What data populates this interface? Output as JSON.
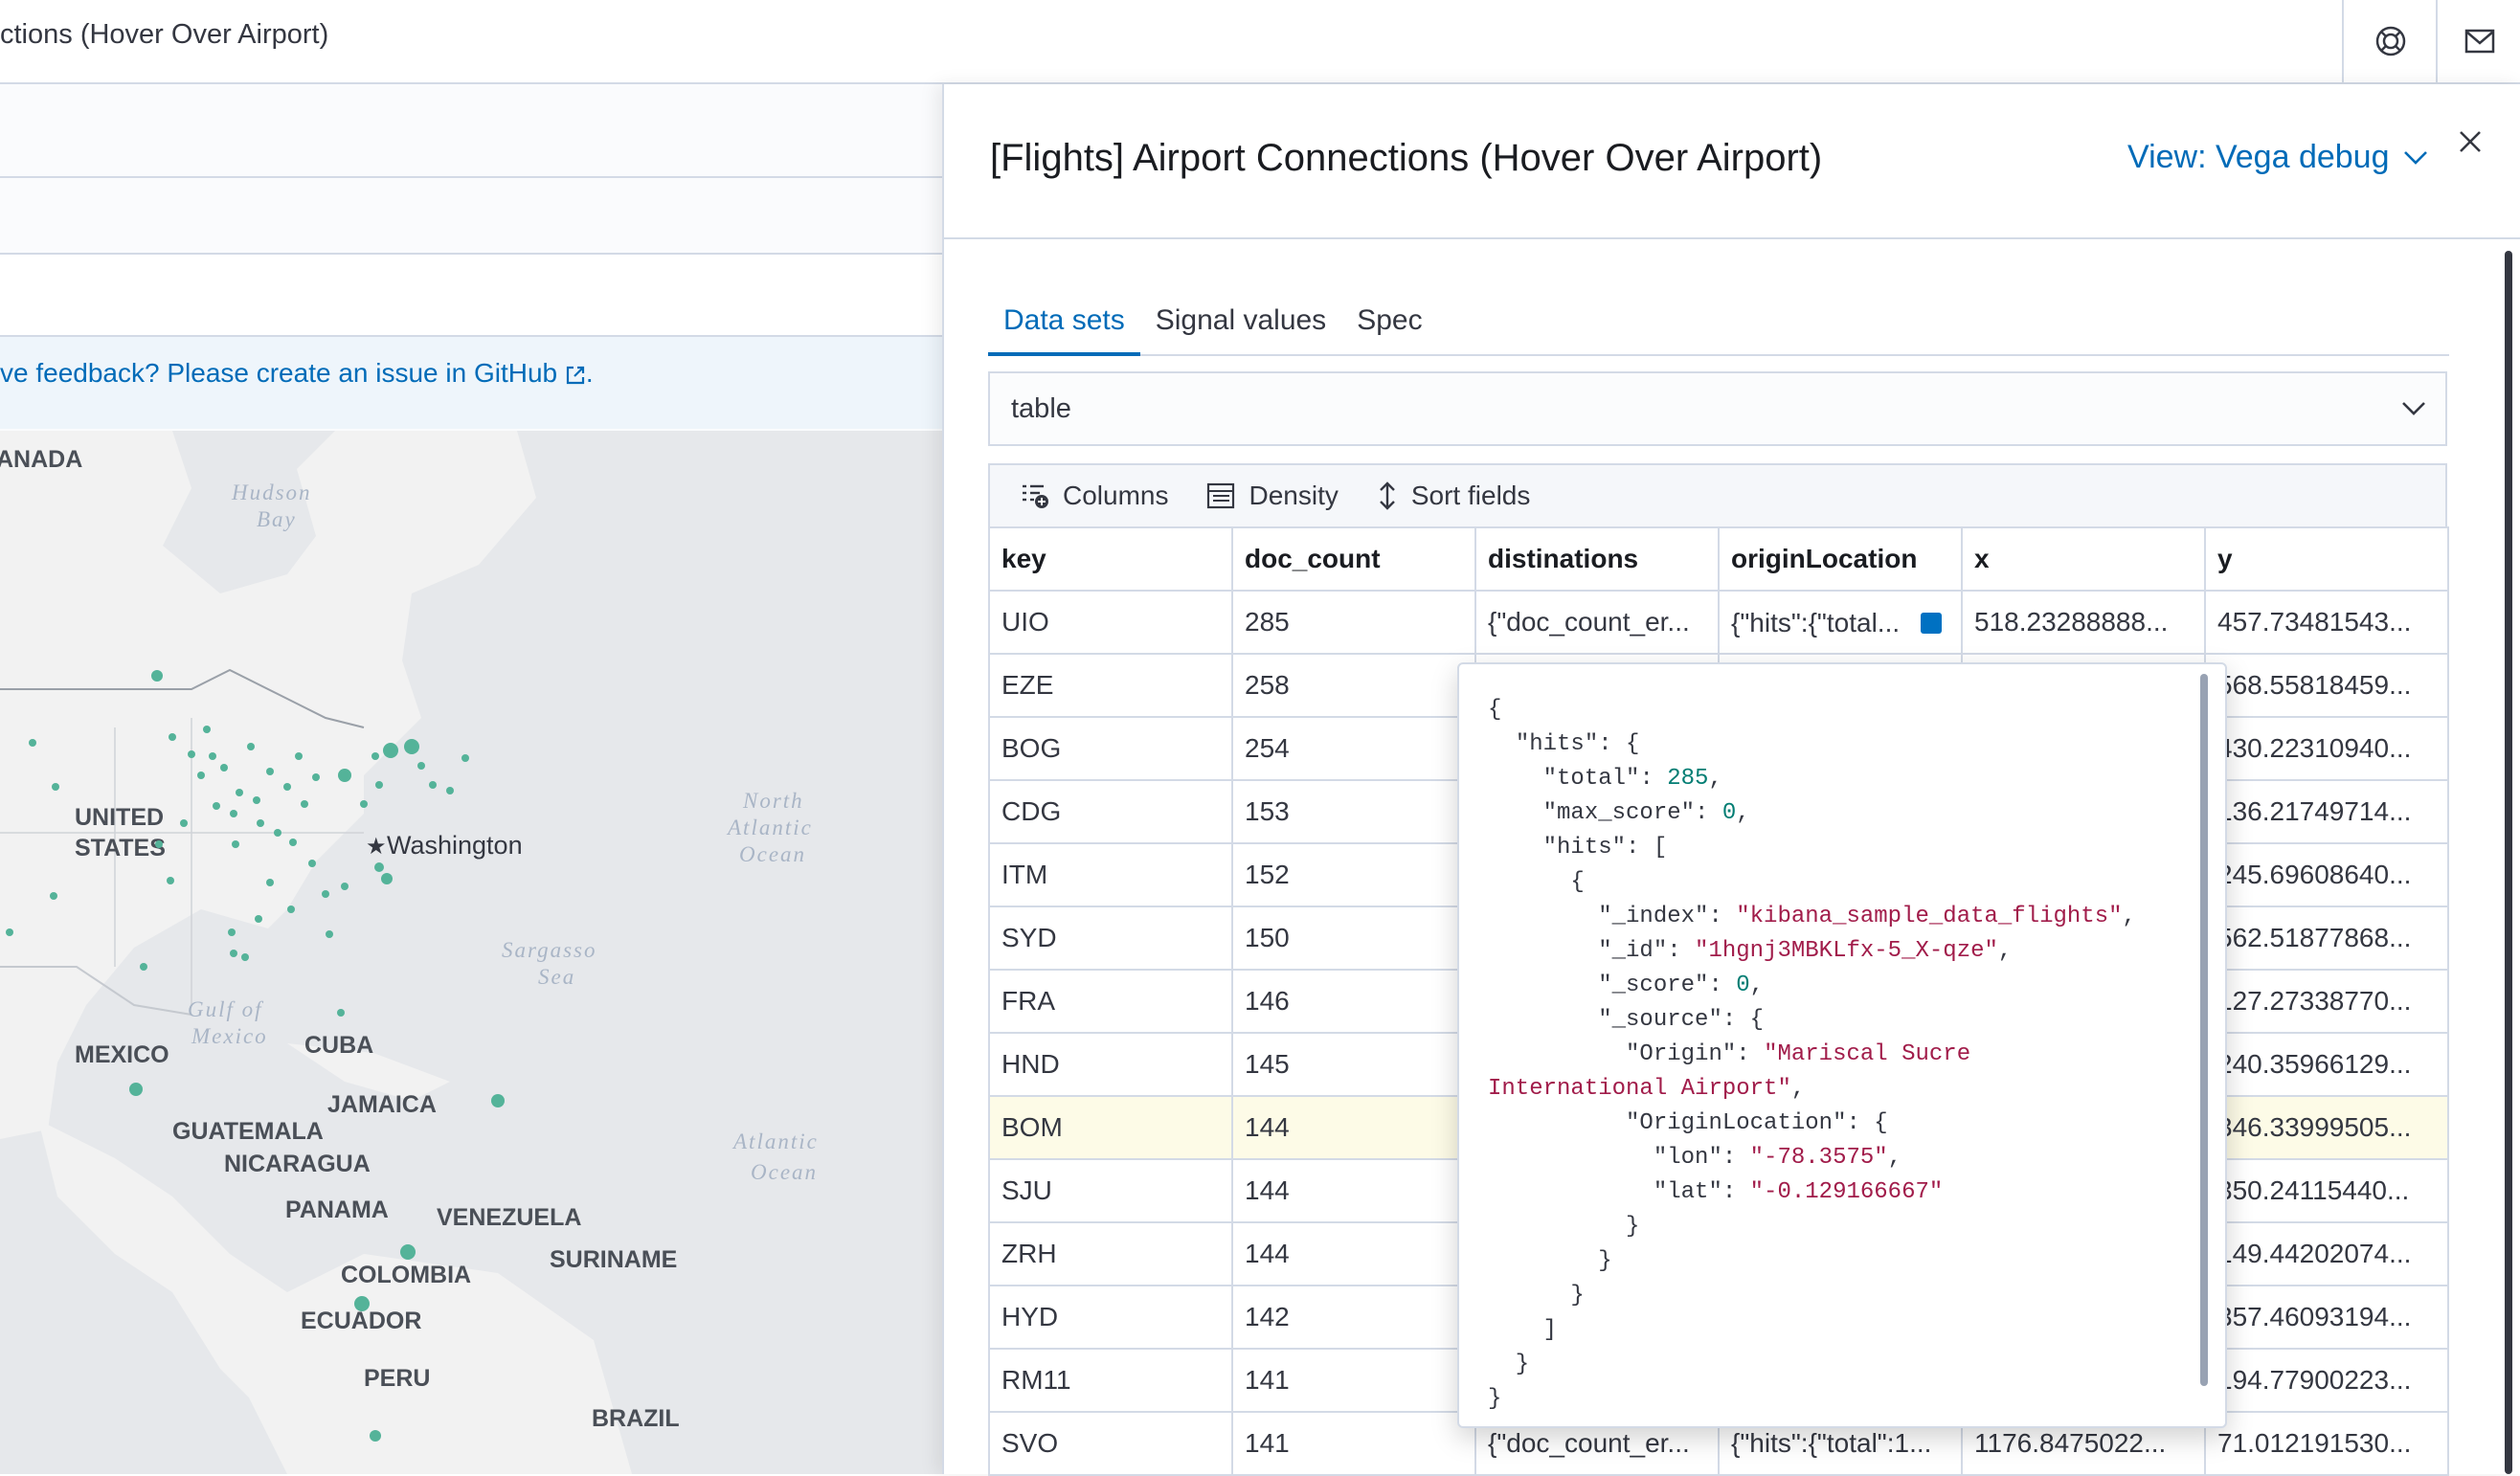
{
  "header": {
    "title": "ctions (Hover Over Airport)",
    "help_icon": "help-icon",
    "mail_icon": "mail-icon"
  },
  "callout": {
    "text": "ve feedback? Please create an issue in GitHub",
    "trailing": "."
  },
  "map": {
    "labels": {
      "canada": "ANADA",
      "united_states_1": "UNITED",
      "united_states_2": "STATES",
      "washington": "Washington",
      "mexico": "MEXICO",
      "cuba": "CUBA",
      "jamaica": "JAMAICA",
      "guatemala": "GUATEMALA",
      "nicaragua": "NICARAGUA",
      "panama": "PANAMA",
      "venezuela": "VENEZUELA",
      "suriname": "SURINAME",
      "colombia": "COLOMBIA",
      "ecuador": "ECUADOR",
      "peru": "PERU",
      "brazil": "BRAZIL",
      "hudson_1": "Hudson",
      "hudson_2": "Bay",
      "north_atlantic_1": "North",
      "north_atlantic_2": "Atlantic",
      "north_atlantic_3": "Ocean",
      "sargasso_1": "Sargasso",
      "sargasso_2": "Sea",
      "gulf_1": "Gulf of",
      "gulf_2": "Mexico",
      "atlantic_1": "Atlantic",
      "atlantic_2": "Ocean"
    },
    "point_color": "#54b399"
  },
  "flyout": {
    "title": "[Flights] Airport Connections (Hover Over Airport)",
    "view_label": "View: Vega debug",
    "tabs": [
      "Data sets",
      "Signal values",
      "Spec"
    ],
    "active_tab": "Data sets",
    "dataset_select": "table",
    "toolbar": {
      "columns": "Columns",
      "density": "Density",
      "sort": "Sort fields"
    },
    "columns": [
      "key",
      "doc_count",
      "distinations",
      "originLocation",
      "x",
      "y"
    ],
    "rows": [
      [
        "UIO",
        "285",
        "{\"doc_count_er...",
        "{\"hits\":{\"total...",
        "518.23288888...",
        "457.73481543..."
      ],
      [
        "EZE",
        "258",
        "",
        "",
        "",
        "568.55818459..."
      ],
      [
        "BOG",
        "254",
        "",
        "",
        "",
        "430.22310940..."
      ],
      [
        "CDG",
        "153",
        "",
        "",
        "",
        "136.21749714..."
      ],
      [
        "ITM",
        "152",
        "",
        "",
        "",
        "245.69608640..."
      ],
      [
        "SYD",
        "150",
        "",
        "",
        "",
        "562.51877868..."
      ],
      [
        "FRA",
        "146",
        "",
        "",
        "",
        "127.27338770..."
      ],
      [
        "HND",
        "145",
        "",
        "",
        "",
        "240.35966129..."
      ],
      [
        "BOM",
        "144",
        "",
        "",
        "",
        "346.33999505..."
      ],
      [
        "SJU",
        "144",
        "",
        "",
        "",
        "350.24115440..."
      ],
      [
        "ZRH",
        "144",
        "",
        "",
        "",
        "149.44202074..."
      ],
      [
        "HYD",
        "142",
        "",
        "",
        "",
        "357.46093194..."
      ],
      [
        "RM11",
        "141",
        "",
        "",
        "",
        "194.77900223..."
      ],
      [
        "SVO",
        "141",
        "{\"doc_count_er...",
        "{\"hits\":{\"total\":1...",
        "1176.8475022...",
        "71.012191530..."
      ]
    ],
    "popover_json": {
      "total": "285",
      "max_score": "0",
      "_index": "\"kibana_sample_data_flights\"",
      "_id": "\"1hgnj3MBKLfx-5_X-qze\"",
      "_score": "0",
      "origin_1": "\"Mariscal Sucre",
      "origin_2": "International Airport\"",
      "lon": "\"-78.3575\"",
      "lat": "\"-0.129166667\""
    }
  }
}
